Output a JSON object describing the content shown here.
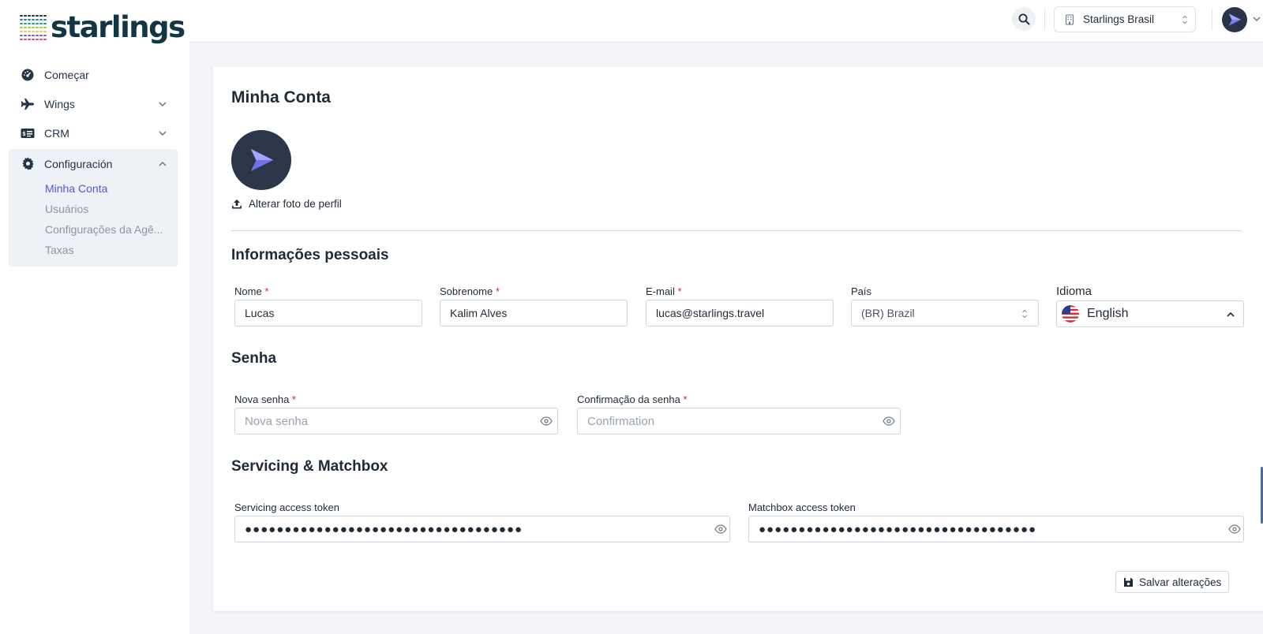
{
  "app": {
    "logo_text": "starlings"
  },
  "sidebar": {
    "items": [
      {
        "label": "Começar",
        "icon": "dashboard-gauge-icon"
      },
      {
        "label": "Wings",
        "icon": "plane-icon"
      },
      {
        "label": "CRM",
        "icon": "id-card-icon"
      },
      {
        "label": "Configuración",
        "icon": "gear-icon"
      }
    ],
    "sub_items": [
      {
        "label": "Minha Conta",
        "active": true
      },
      {
        "label": "Usuários",
        "active": false
      },
      {
        "label": "Configurações da Agê...",
        "active": false
      },
      {
        "label": "Taxas",
        "active": false
      }
    ]
  },
  "topbar": {
    "org_selector_value": "Starlings Brasil",
    "icons": [
      "search-icon",
      "building-icon",
      "avatar-icon",
      "chevron-down-icon"
    ]
  },
  "page": {
    "title": "Minha Conta",
    "change_photo_label": "Alterar foto de perfil",
    "personal": {
      "heading": "Informações pessoais",
      "first_name": {
        "label": "Nome",
        "required_mark": "*",
        "value": "Lucas"
      },
      "last_name": {
        "label": "Sobrenome",
        "required_mark": "*",
        "value": "Kalim Alves"
      },
      "email": {
        "label": "E-mail",
        "required_mark": "*",
        "value": "lucas@starlings.travel"
      },
      "country": {
        "label": "País",
        "value": "(BR) Brazil"
      },
      "language": {
        "label": "Idioma",
        "value": "English",
        "flag": "us-flag-icon"
      }
    },
    "password": {
      "heading": "Senha",
      "new": {
        "label": "Nova senha",
        "required_mark": "*",
        "placeholder": "Nova senha",
        "value": ""
      },
      "confirm": {
        "label": "Confirmação da senha",
        "required_mark": "*",
        "placeholder": "Confirmation",
        "value": ""
      }
    },
    "servicing": {
      "heading": "Servicing & Matchbox",
      "servicing_token": {
        "label": "Servicing access token",
        "masked_value": "●●●●●●●●●●●●●●●●●●●●●●●●●●●●●●●●●●●"
      },
      "matchbox_token": {
        "label": "Matchbox access token",
        "masked_value": "●●●●●●●●●●●●●●●●●●●●●●●●●●●●●●●●●●●"
      }
    },
    "save_label": "Salvar alterações"
  },
  "colors": {
    "brand_dark": "#133644",
    "accent": "#5457d6",
    "required": "#e02424",
    "page_bg": "#f3f5f8"
  }
}
